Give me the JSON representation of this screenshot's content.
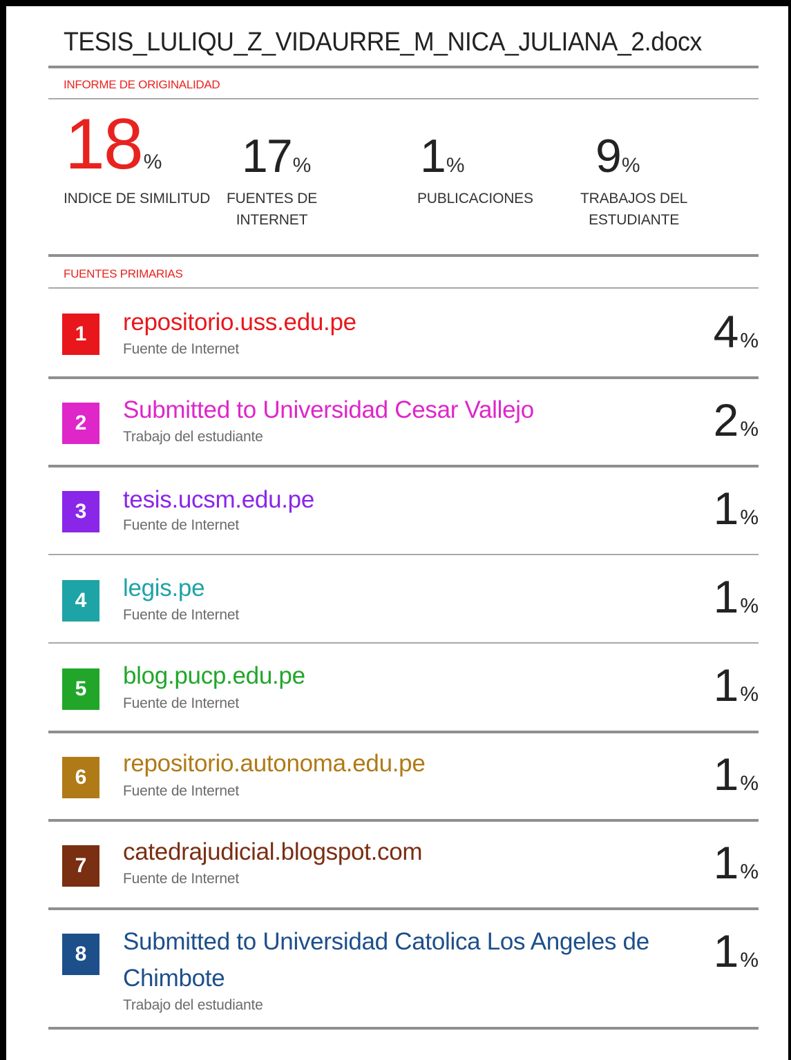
{
  "document": {
    "title": "TESIS_LULIQU_Z_VIDAURRE_M_NICA_JULIANA_2.docx"
  },
  "report": {
    "section_label": "INFORME DE ORIGINALIDAD",
    "stats": [
      {
        "value": "18",
        "unit": "%",
        "label": "INDICE DE SIMILITUD"
      },
      {
        "value": "17",
        "unit": "%",
        "label": "FUENTES DE\nINTERNET"
      },
      {
        "value": "1",
        "unit": "%",
        "label": "PUBLICACIONES"
      },
      {
        "value": "9",
        "unit": "%",
        "label": "TRABAJOS DEL\nESTUDIANTE"
      }
    ]
  },
  "sources": {
    "section_label": "FUENTES PRIMARIAS",
    "items": [
      {
        "rank": "1",
        "name": "repositorio.uss.edu.pe",
        "type": "Fuente de Internet",
        "percent": "4",
        "unit": "%",
        "color": "#e8171c"
      },
      {
        "rank": "2",
        "name": "Submitted to Universidad Cesar Vallejo",
        "type": "Trabajo del estudiante",
        "percent": "2",
        "unit": "%",
        "color": "#de26c9"
      },
      {
        "rank": "3",
        "name": "tesis.ucsm.edu.pe",
        "type": "Fuente de Internet",
        "percent": "1",
        "unit": "%",
        "color": "#8a26e8"
      },
      {
        "rank": "4",
        "name": "legis.pe",
        "type": "Fuente de Internet",
        "percent": "1",
        "unit": "%",
        "color": "#1ea3a6"
      },
      {
        "rank": "5",
        "name": "blog.pucp.edu.pe",
        "type": "Fuente de Internet",
        "percent": "1",
        "unit": "%",
        "color": "#21a62a"
      },
      {
        "rank": "6",
        "name": "repositorio.autonoma.edu.pe",
        "type": "Fuente de Internet",
        "percent": "1",
        "unit": "%",
        "color": "#b07a17"
      },
      {
        "rank": "7",
        "name": "catedrajudicial.blogspot.com",
        "type": "Fuente de Internet",
        "percent": "1",
        "unit": "%",
        "color": "#7a2e12"
      },
      {
        "rank": "8",
        "name": "Submitted to Universidad Catolica Los Angeles de Chimbote",
        "type": "Trabajo del estudiante",
        "percent": "1",
        "unit": "%",
        "color": "#1d4f8a"
      }
    ]
  }
}
